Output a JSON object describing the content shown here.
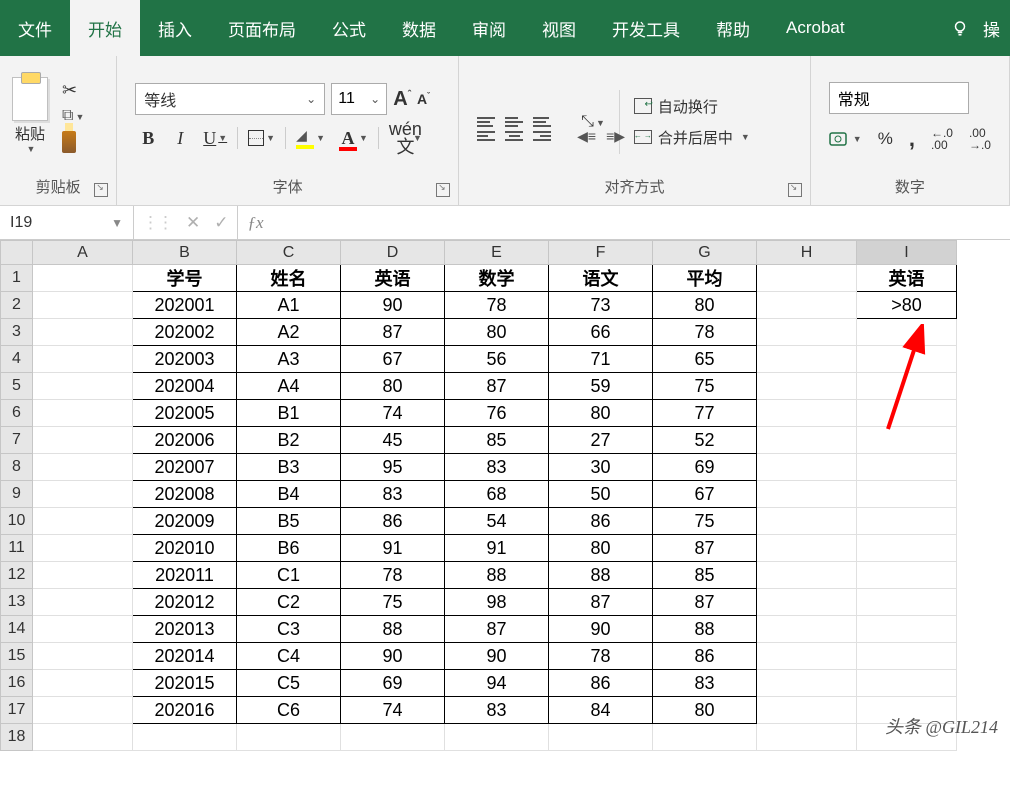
{
  "tabs": [
    "文件",
    "开始",
    "插入",
    "页面布局",
    "公式",
    "数据",
    "审阅",
    "视图",
    "开发工具",
    "帮助",
    "Acrobat"
  ],
  "tell_me": "操",
  "clipboard": {
    "paste": "粘贴",
    "group": "剪贴板"
  },
  "font": {
    "name": "等线",
    "size": "11",
    "group": "字体",
    "bold": "B",
    "italic": "I",
    "underline": "U",
    "wen_top": "wén",
    "wen_bot": "文"
  },
  "align": {
    "group": "对齐方式",
    "wrap": "自动换行",
    "merge": "合并后居中"
  },
  "number": {
    "group": "数字",
    "format": "常规",
    "percent": "%",
    "comma": ",",
    "inc": ".0\n.00",
    "dec": ".00\n.0"
  },
  "name_box": "I19",
  "columns": [
    "A",
    "B",
    "C",
    "D",
    "E",
    "F",
    "G",
    "H",
    "I"
  ],
  "row_headers": [
    "1",
    "2",
    "3",
    "4",
    "5",
    "6",
    "7",
    "8",
    "9",
    "10",
    "11",
    "12",
    "13",
    "14",
    "15",
    "16",
    "17",
    "18"
  ],
  "headers": [
    "学号",
    "姓名",
    "英语",
    "数学",
    "语文",
    "平均"
  ],
  "rows": [
    [
      "202001",
      "A1",
      "90",
      "78",
      "73",
      "80"
    ],
    [
      "202002",
      "A2",
      "87",
      "80",
      "66",
      "78"
    ],
    [
      "202003",
      "A3",
      "67",
      "56",
      "71",
      "65"
    ],
    [
      "202004",
      "A4",
      "80",
      "87",
      "59",
      "75"
    ],
    [
      "202005",
      "B1",
      "74",
      "76",
      "80",
      "77"
    ],
    [
      "202006",
      "B2",
      "45",
      "85",
      "27",
      "52"
    ],
    [
      "202007",
      "B3",
      "95",
      "83",
      "30",
      "69"
    ],
    [
      "202008",
      "B4",
      "83",
      "68",
      "50",
      "67"
    ],
    [
      "202009",
      "B5",
      "86",
      "54",
      "86",
      "75"
    ],
    [
      "202010",
      "B6",
      "91",
      "91",
      "80",
      "87"
    ],
    [
      "202011",
      "C1",
      "78",
      "88",
      "88",
      "85"
    ],
    [
      "202012",
      "C2",
      "75",
      "98",
      "87",
      "87"
    ],
    [
      "202013",
      "C3",
      "88",
      "87",
      "90",
      "88"
    ],
    [
      "202014",
      "C4",
      "90",
      "90",
      "78",
      "86"
    ],
    [
      "202015",
      "C5",
      "69",
      "94",
      "86",
      "83"
    ],
    [
      "202016",
      "C6",
      "74",
      "83",
      "84",
      "80"
    ]
  ],
  "criteria": {
    "header": "英语",
    "value": ">80"
  },
  "watermark": "头条 @GIL214"
}
